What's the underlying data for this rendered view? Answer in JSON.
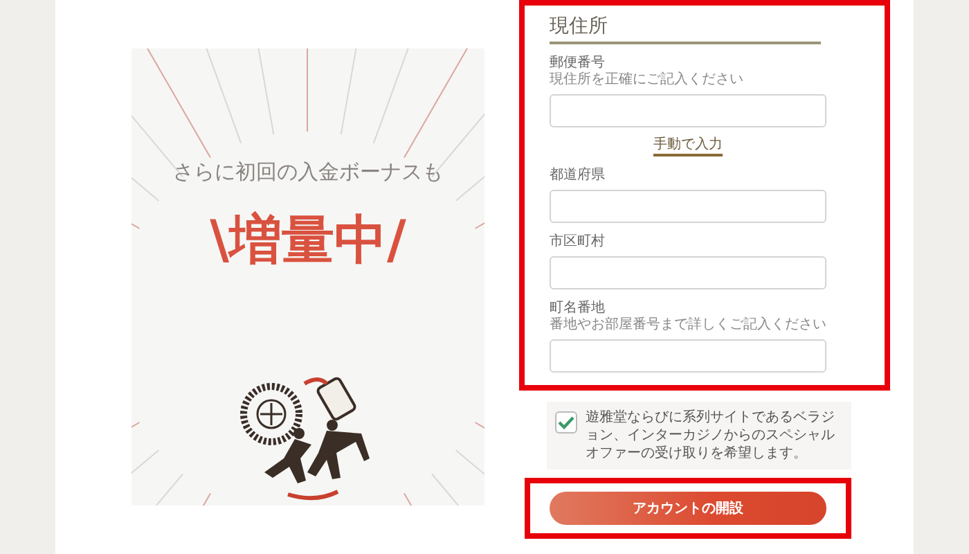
{
  "poster": {
    "subtitle": "さらに初回の入金ボーナスも",
    "headline": "\\増量中/"
  },
  "address": {
    "title": "現住所",
    "items": [
      {
        "kind": "field",
        "label": "郵便番号",
        "hint": "現住所を正確にご記入ください"
      },
      {
        "kind": "link",
        "label": "手動で入力"
      },
      {
        "kind": "field",
        "label": "都道府県"
      },
      {
        "kind": "field",
        "label": "市区町村"
      },
      {
        "kind": "field",
        "label": "町名番地",
        "hint": "番地やお部屋番号まで詳しくご記入ください"
      }
    ]
  },
  "offer": {
    "checked": true,
    "text": "遊雅堂ならびに系列サイトであるベラジョン、インターカジノからのスペシャルオファーの受け取りを希望します。"
  },
  "submit": {
    "label": "アカウントの開設"
  }
}
